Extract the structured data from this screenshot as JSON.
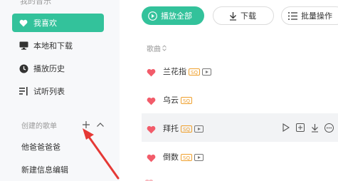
{
  "sidebar": {
    "top_label": "我的音乐",
    "items": [
      {
        "label": "我喜欢",
        "icon": "heart-icon",
        "active": true
      },
      {
        "label": "本地和下载",
        "icon": "monitor-icon",
        "active": false
      },
      {
        "label": "播放历史",
        "icon": "clock-icon",
        "active": false
      },
      {
        "label": "试听列表",
        "icon": "playlist-icon",
        "active": false
      }
    ],
    "created_playlists": {
      "title": "创建的歌单",
      "add_icon": "plus-icon",
      "collapse_icon": "chevron-up-icon",
      "items": [
        {
          "label": "他爸爸爸爸"
        },
        {
          "label": "新建信息编辑"
        }
      ]
    }
  },
  "toolbar": {
    "play_all_label": "播放全部",
    "download_label": "下载",
    "batch_label": "批量操作"
  },
  "song_list": {
    "column_header": "歌曲",
    "songs": [
      {
        "title": "兰花指",
        "quality": "SQ",
        "has_mv": true,
        "liked": true
      },
      {
        "title": "乌云",
        "quality": "SQ",
        "has_mv": false,
        "liked": true
      },
      {
        "title": "拜托",
        "quality": "SQ",
        "has_mv": true,
        "liked": true,
        "hovered": true
      },
      {
        "title": "倒数",
        "quality": "SQ",
        "has_mv": true,
        "liked": true
      }
    ]
  },
  "colors": {
    "accent": "#33c29b",
    "heart": "#f25c6a",
    "sq_badge": "#ef9f2b",
    "arrow": "#e53935"
  }
}
